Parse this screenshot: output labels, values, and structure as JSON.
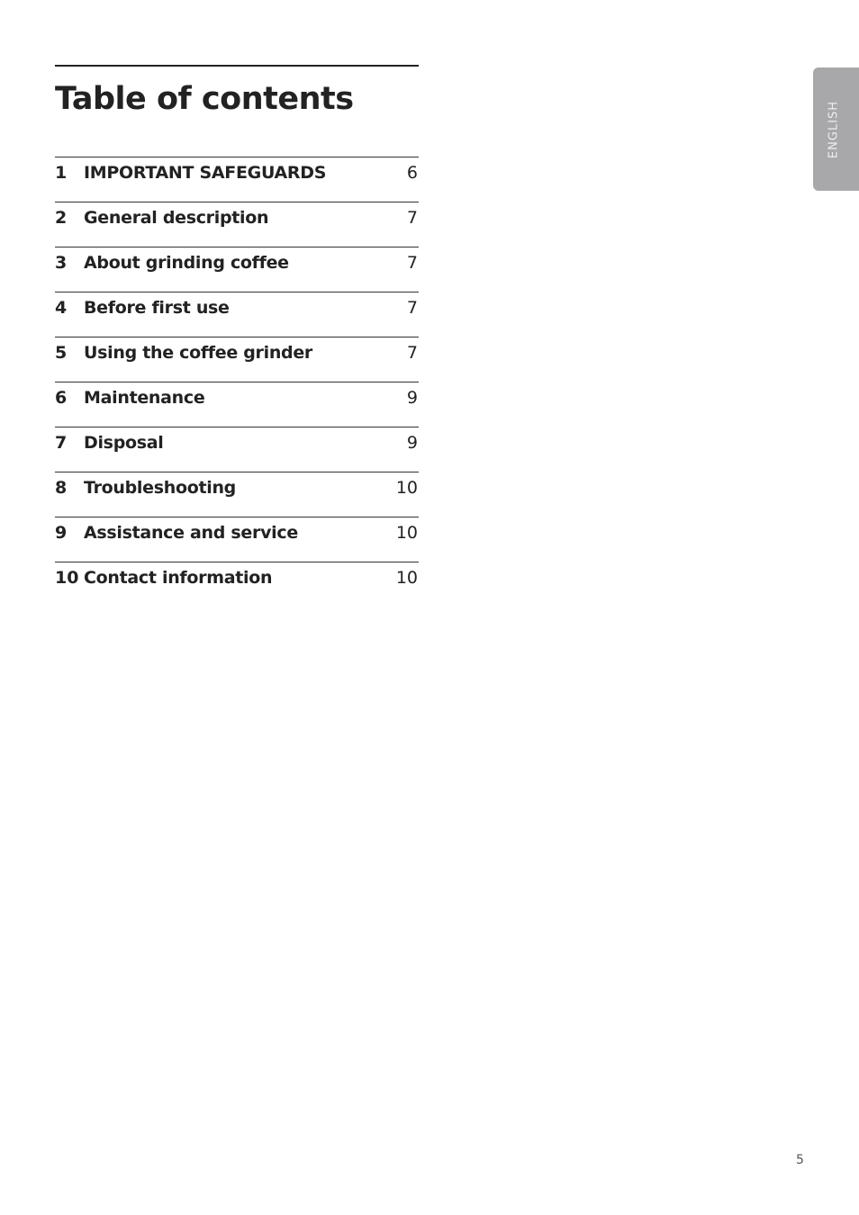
{
  "title": "Table of contents",
  "toc": [
    {
      "num": "1",
      "label": "IMPORTANT SAFEGUARDS",
      "page": "6"
    },
    {
      "num": "2",
      "label": "General description",
      "page": "7"
    },
    {
      "num": "3",
      "label": "About grinding coffee",
      "page": "7"
    },
    {
      "num": "4",
      "label": "Before first use",
      "page": "7"
    },
    {
      "num": "5",
      "label": "Using the coffee grinder",
      "page": "7"
    },
    {
      "num": "6",
      "label": "Maintenance",
      "page": "9"
    },
    {
      "num": "7",
      "label": "Disposal",
      "page": "9"
    },
    {
      "num": "8",
      "label": "Troubleshooting",
      "page": "10"
    },
    {
      "num": "9",
      "label": "Assistance and service",
      "page": "10"
    },
    {
      "num": "10",
      "label": "Contact information",
      "page": "10"
    }
  ],
  "language_tab": "ENGLISH",
  "page_number": "5"
}
